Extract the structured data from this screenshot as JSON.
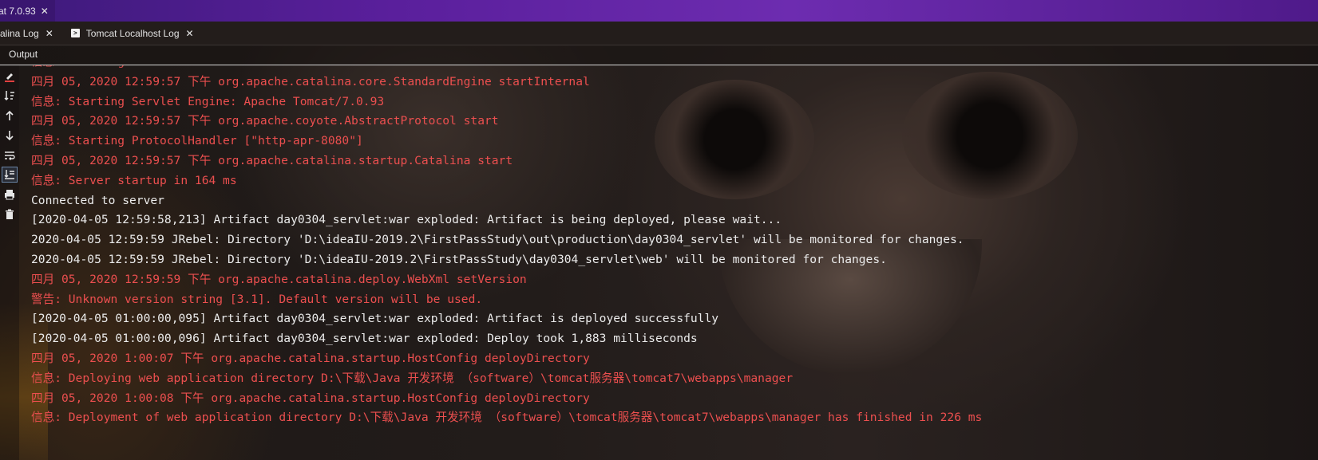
{
  "window": {
    "title": "at 7.0.93"
  },
  "tabs": [
    {
      "label": "alina Log"
    },
    {
      "label": "Tomcat Localhost Log"
    }
  ],
  "panel": {
    "label": "Output"
  },
  "toolbar": {
    "icons": [
      "clear-icon",
      "sort-icon",
      "up-arrow-icon",
      "down-arrow-icon",
      "soft-wrap-icon",
      "scroll-to-end-icon",
      "print-icon",
      "trash-icon"
    ]
  },
  "colors": {
    "error_text": "#ec4f4f",
    "normal_text": "#ebebeb",
    "title_bar": "#5a1f9c"
  },
  "log_lines": [
    {
      "text": "信息: Starting Service Catalina",
      "level": "red"
    },
    {
      "text": "四月 05, 2020 12:59:57 下午 org.apache.catalina.core.StandardEngine startInternal",
      "level": "red"
    },
    {
      "text": "信息: Starting Servlet Engine: Apache Tomcat/7.0.93",
      "level": "red"
    },
    {
      "text": "四月 05, 2020 12:59:57 下午 org.apache.coyote.AbstractProtocol start",
      "level": "red"
    },
    {
      "text": "信息: Starting ProtocolHandler [\"http-apr-8080\"]",
      "level": "red"
    },
    {
      "text": "四月 05, 2020 12:59:57 下午 org.apache.catalina.startup.Catalina start",
      "level": "red"
    },
    {
      "text": "信息: Server startup in 164 ms",
      "level": "red"
    },
    {
      "text": "Connected to server",
      "level": "white"
    },
    {
      "text": "[2020-04-05 12:59:58,213] Artifact day0304_servlet:war exploded: Artifact is being deployed, please wait...",
      "level": "white"
    },
    {
      "text": "2020-04-05 12:59:59 JRebel: Directory 'D:\\ideaIU-2019.2\\FirstPassStudy\\out\\production\\day0304_servlet' will be monitored for changes.",
      "level": "white"
    },
    {
      "text": "2020-04-05 12:59:59 JRebel: Directory 'D:\\ideaIU-2019.2\\FirstPassStudy\\day0304_servlet\\web' will be monitored for changes.",
      "level": "white"
    },
    {
      "text": "四月 05, 2020 12:59:59 下午 org.apache.catalina.deploy.WebXml setVersion",
      "level": "red"
    },
    {
      "text": "警告: Unknown version string [3.1]. Default version will be used.",
      "level": "red"
    },
    {
      "text": "[2020-04-05 01:00:00,095] Artifact day0304_servlet:war exploded: Artifact is deployed successfully",
      "level": "white"
    },
    {
      "text": "[2020-04-05 01:00:00,096] Artifact day0304_servlet:war exploded: Deploy took 1,883 milliseconds",
      "level": "white"
    },
    {
      "text": "四月 05, 2020 1:00:07 下午 org.apache.catalina.startup.HostConfig deployDirectory",
      "level": "red"
    },
    {
      "text": "信息: Deploying web application directory D:\\下载\\Java 开发环境 （software）\\tomcat服务器\\tomcat7\\webapps\\manager",
      "level": "red"
    },
    {
      "text": "四月 05, 2020 1:00:08 下午 org.apache.catalina.startup.HostConfig deployDirectory",
      "level": "red"
    },
    {
      "text": "信息: Deployment of web application directory D:\\下载\\Java 开发环境 （software）\\tomcat服务器\\tomcat7\\webapps\\manager has finished in 226 ms",
      "level": "red"
    }
  ]
}
